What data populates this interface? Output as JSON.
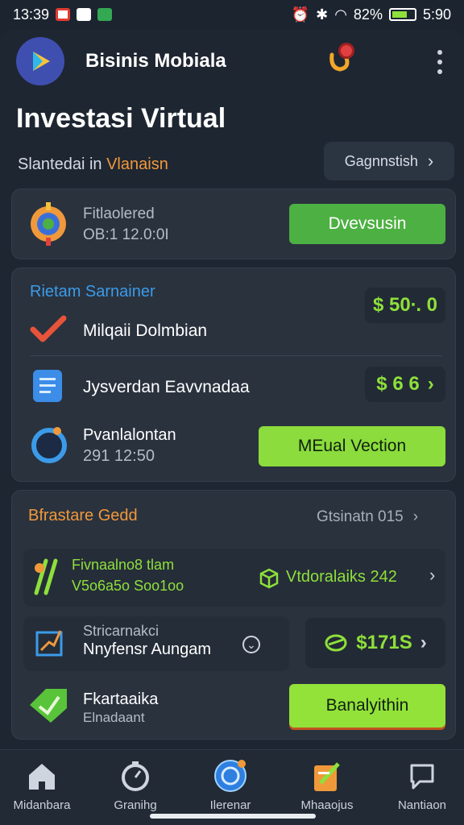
{
  "status_bar": {
    "time_left": "13:39",
    "battery": "82%",
    "time_right": "5:90"
  },
  "header": {
    "app_name": "Bisinis Mobiala",
    "page_title": "Investasi Virtual",
    "subtitle_prefix": "Slantedai in",
    "subtitle_accent": "Vlanaisn",
    "top_button_label": "Gagnnstish",
    "notification_badge": ""
  },
  "card1": {
    "title": "Fitlaolered",
    "time": "OB:1 12.0:0I",
    "button_label": "Dvevsusin"
  },
  "card2": {
    "section_title": "Rietam Sarnainer",
    "value1": "$ 50∙. 0",
    "row1_label": "Milqaii Dolmbian",
    "row2_label": "Jysverdan Eavvnadaa",
    "value2": "$ 6 6",
    "row3_label": "Pvanlalontan",
    "row3_time": "291 12:50",
    "row3_button": "MEual Vection"
  },
  "card3": {
    "section_title": "Bfrastare Gedd",
    "header_right": "Gtsinatn 015",
    "item1_line1": "Fivnaalno8 tlam",
    "item1_line2": "V5o6a5o Soo1oo",
    "item1_right": "Vtdoralaiks 242",
    "item2_line1": "Stricarnakci",
    "item2_line2": "Nnyfensr Aungam",
    "item2_value": "$171S",
    "item3_line1": "Fkartaaika",
    "item3_line2": "Elnadaant",
    "item3_button": "Banalyithin"
  },
  "bottom_nav": [
    {
      "label": "Midanbara",
      "icon": "home-icon"
    },
    {
      "label": "Granihg",
      "icon": "timer-icon"
    },
    {
      "label": "Ilerenar",
      "icon": "target-icon"
    },
    {
      "label": "Mhaaojus",
      "icon": "notes-icon"
    },
    {
      "label": "Nantiaon",
      "icon": "chat-icon"
    }
  ],
  "colors": {
    "accent_green": "#8ee03a",
    "button_green": "#4db043",
    "accent_orange": "#f0993a",
    "accent_blue": "#3b9be8",
    "background": "#1e2632",
    "card": "#2a323e"
  }
}
